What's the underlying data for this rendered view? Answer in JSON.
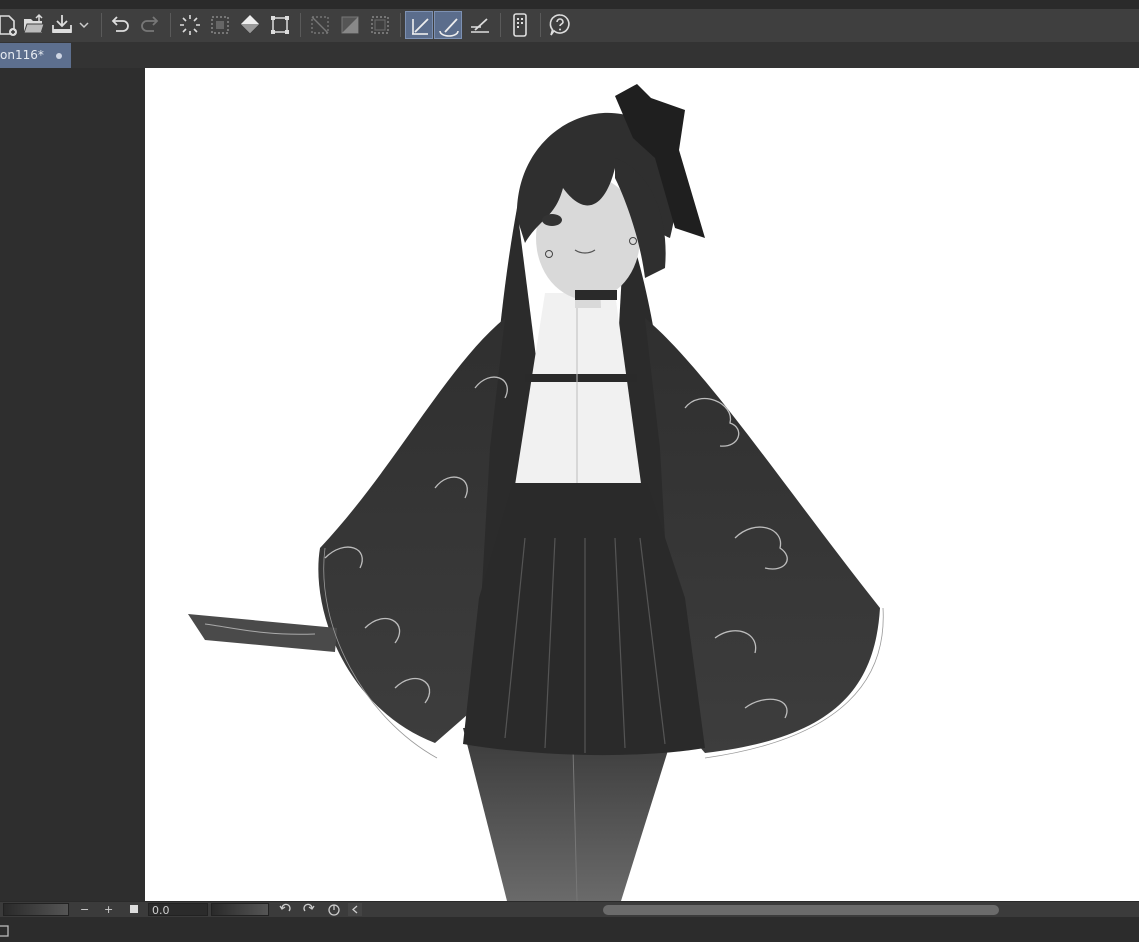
{
  "document": {
    "tab_label": "on116*"
  },
  "toolbar": {
    "buttons": [
      {
        "name": "new-file",
        "icon": "new-file-icon"
      },
      {
        "name": "open-file",
        "icon": "folder-open-icon"
      },
      {
        "name": "save",
        "icon": "save-icon"
      },
      {
        "name": "save-options",
        "icon": "chevron-down-icon"
      },
      {
        "name": "undo",
        "icon": "undo-icon"
      },
      {
        "name": "redo",
        "icon": "redo-icon"
      },
      {
        "name": "deselect",
        "icon": "selection-burst-icon"
      },
      {
        "name": "select-all",
        "icon": "selection-dotted-icon"
      },
      {
        "name": "fill",
        "icon": "paint-bucket-icon"
      },
      {
        "name": "transform",
        "icon": "transform-icon"
      },
      {
        "name": "hide-selection",
        "icon": "clear-selection-icon"
      },
      {
        "name": "invert-selection",
        "icon": "invert-selection-icon"
      },
      {
        "name": "selection-border",
        "icon": "selection-border-icon"
      },
      {
        "name": "snap-to-ruler",
        "icon": "ruler-snap-icon",
        "active": true
      },
      {
        "name": "snap-to-special-ruler",
        "icon": "special-ruler-snap-icon",
        "active": true
      },
      {
        "name": "snap-to-grid",
        "icon": "grid-snap-icon"
      },
      {
        "name": "companion-mode",
        "icon": "smartphone-icon"
      },
      {
        "name": "help",
        "icon": "help-icon"
      }
    ]
  },
  "statusbar": {
    "zoom_out_label": "−",
    "zoom_in_label": "+",
    "angle_value": "0.0"
  },
  "colors": {
    "active_accent": "#5b6d8c",
    "canvas": "#ffffff",
    "panel": "#2e2e2e"
  }
}
